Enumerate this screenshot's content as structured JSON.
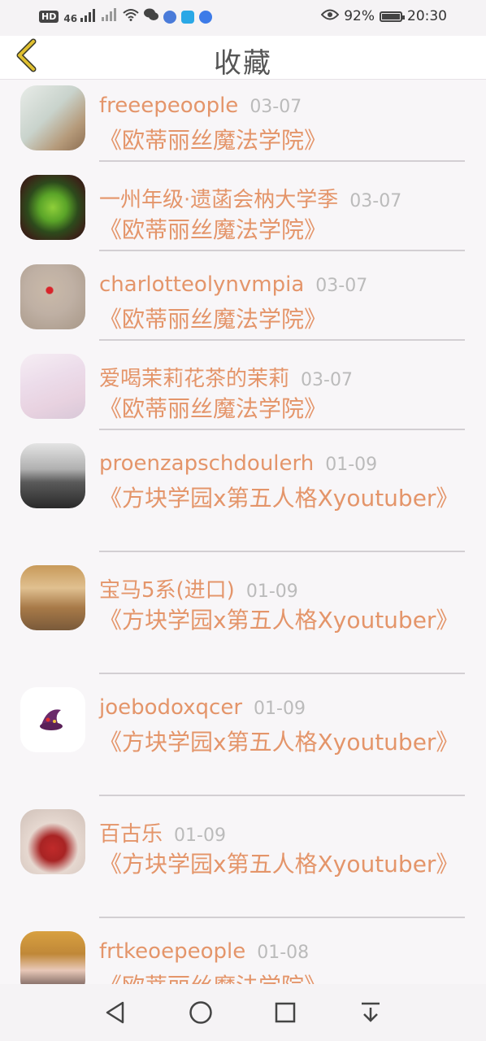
{
  "status_bar": {
    "network_badge": "HD",
    "signal_label": "46",
    "battery_percent": "92%",
    "time": "20:30",
    "icons": [
      "hd-icon",
      "signal-icon",
      "wifi-icon",
      "wechat-icon",
      "music-icon",
      "app-icon",
      "browser-icon",
      "eye-icon",
      "battery-icon"
    ]
  },
  "header": {
    "title": "收藏",
    "back_icon": "chevron-left-icon"
  },
  "favorites": [
    {
      "name": "freeepeoople",
      "date": "03-07",
      "book": "《欧蒂丽丝魔法学院》"
    },
    {
      "name": "一州年级·遗菡会枘大学季",
      "date": "03-07",
      "book": "《欧蒂丽丝魔法学院》"
    },
    {
      "name": "charlotteolynvmpia",
      "date": "03-07",
      "book": "《欧蒂丽丝魔法学院》"
    },
    {
      "name": "爱喝茉莉花茶的茉莉",
      "date": "03-07",
      "book": "《欧蒂丽丝魔法学院》"
    },
    {
      "name": "proenzapschdoulerh",
      "date": "01-09",
      "book": "《方块学园x第五人格Xyoutuber》"
    },
    {
      "name": "宝马5系(进口)",
      "date": "01-09",
      "book": "《方块学园x第五人格Xyoutuber》"
    },
    {
      "name": "joebodoxqcer",
      "date": "01-09",
      "book": "《方块学园x第五人格Xyoutuber》"
    },
    {
      "name": "百古乐",
      "date": "01-09",
      "book": "《方块学园x第五人格Xyoutuber》"
    },
    {
      "name": "frtkeoepeople",
      "date": "01-08",
      "book": "《欧蒂丽丝魔法学院》"
    }
  ],
  "colors": {
    "accent": "#e4956a",
    "date": "#bbbbbb",
    "back_icon": "#d8b020"
  },
  "navbar": {
    "icons": [
      "back-triangle-icon",
      "home-circle-icon",
      "recents-square-icon",
      "notification-pulldown-icon"
    ]
  }
}
